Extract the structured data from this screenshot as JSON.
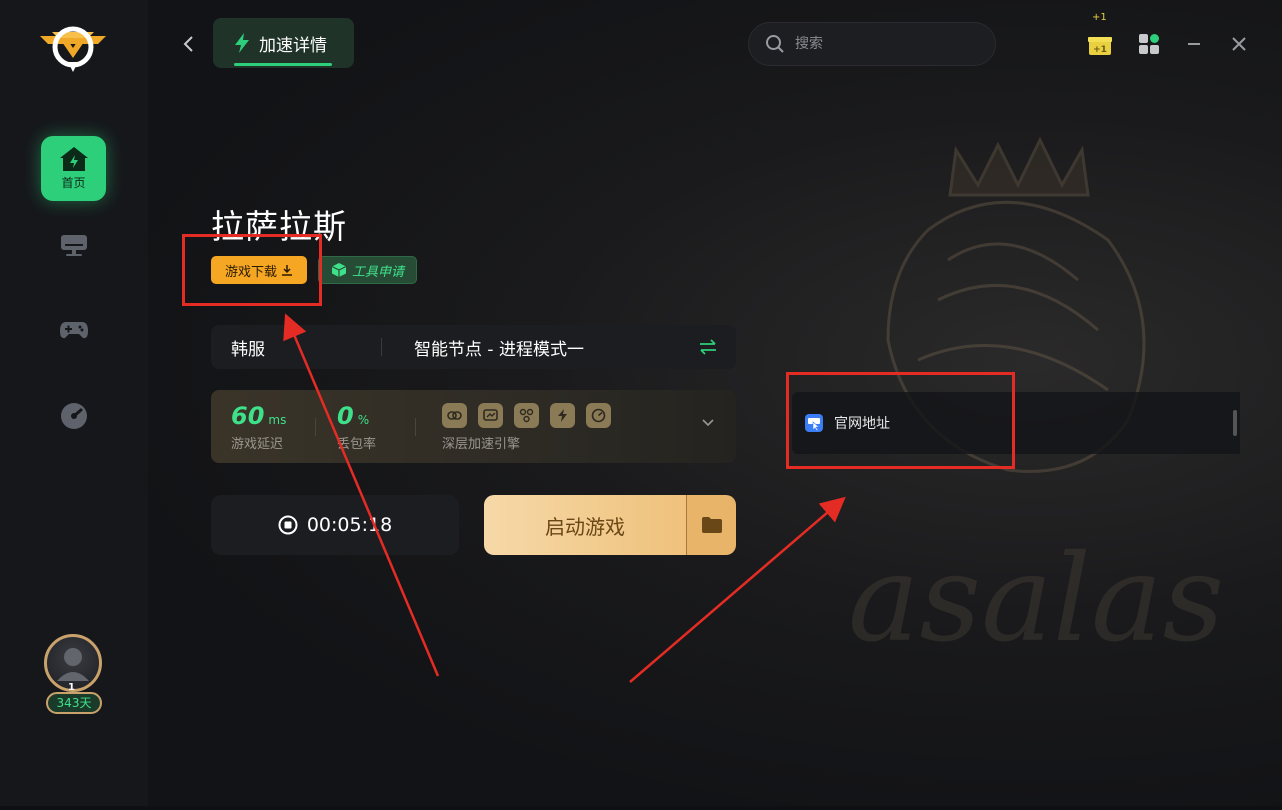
{
  "header": {
    "tab_label": "加速详情",
    "search_placeholder": "搜索",
    "badge_plus": "+1"
  },
  "sidebar": {
    "home_label": "首页",
    "days": "343天",
    "level": "1"
  },
  "game": {
    "title": "拉萨拉斯",
    "download_label": "游戏下载",
    "tool_label": "工具申请",
    "region": "韩服",
    "node": "智能节点 - 进程模式一"
  },
  "stats": {
    "latency_value": "60",
    "latency_unit": "ms",
    "latency_label": "游戏延迟",
    "loss_value": "0",
    "loss_unit": "%",
    "loss_label": "丢包率",
    "engine_label": "深层加速引擎"
  },
  "actions": {
    "timer": "00:05:18",
    "launch_label": "启动游戏"
  },
  "website": {
    "label": "官网地址"
  },
  "colors": {
    "accent_green": "#2ecf7a",
    "download_orange": "#f5a623",
    "annotation_red": "#e42b24",
    "launch_gold": "#efc17c"
  }
}
